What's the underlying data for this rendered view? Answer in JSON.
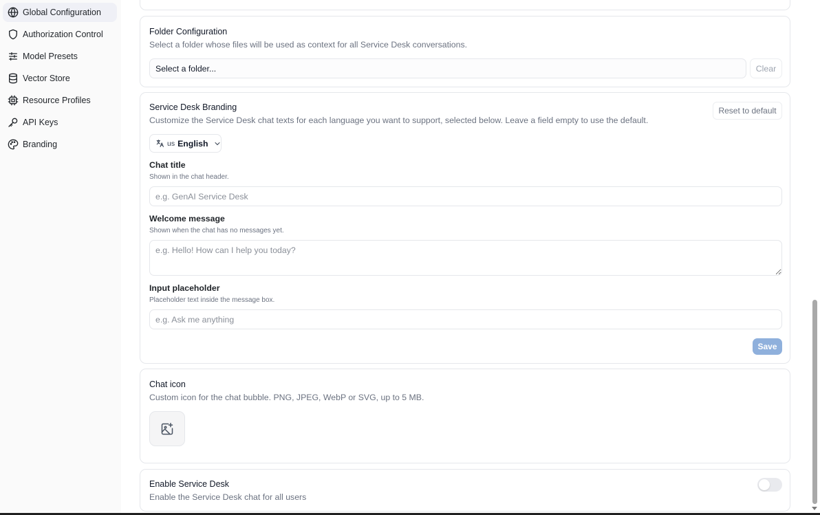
{
  "sidebar": {
    "items": [
      {
        "label": "Global Configuration",
        "icon": "globe-icon",
        "active": true
      },
      {
        "label": "Authorization Control",
        "icon": "shield-icon"
      },
      {
        "label": "Model Presets",
        "icon": "sliders-icon"
      },
      {
        "label": "Vector Store",
        "icon": "database-icon"
      },
      {
        "label": "Resource Profiles",
        "icon": "cpu-icon"
      },
      {
        "label": "API Keys",
        "icon": "key-icon"
      },
      {
        "label": "Branding",
        "icon": "palette-icon"
      }
    ]
  },
  "folder_config": {
    "title": "Folder Configuration",
    "description": "Select a folder whose files will be used as context for all Service Desk conversations.",
    "select_value": "Select a folder...",
    "clear_label": "Clear"
  },
  "branding": {
    "title": "Service Desk Branding",
    "description": "Customize the Service Desk chat texts for each language you want to support, selected below. Leave a field empty to use the default.",
    "reset_label": "Reset to default",
    "language": {
      "flag": "us",
      "name": "English"
    },
    "chat_title": {
      "label": "Chat title",
      "help": "Shown in the chat header.",
      "placeholder": "e.g. GenAI Service Desk"
    },
    "welcome": {
      "label": "Welcome message",
      "help": "Shown when the chat has no messages yet.",
      "placeholder": "e.g. Hello! How can I help you today?"
    },
    "input_placeholder": {
      "label": "Input placeholder",
      "help": "Placeholder text inside the message box.",
      "placeholder": "e.g. Ask me anything"
    },
    "save_label": "Save"
  },
  "chat_icon": {
    "title": "Chat icon",
    "description": "Custom icon for the chat bubble. PNG, JPEG, WebP or SVG, up to 5 MB."
  },
  "enable_desk": {
    "title": "Enable Service Desk",
    "description": "Enable the Service Desk chat for all users",
    "enabled": false
  },
  "colors": {
    "accent_disabled": "#8fb0dc",
    "active_nav_bg": "#eff0f6"
  }
}
